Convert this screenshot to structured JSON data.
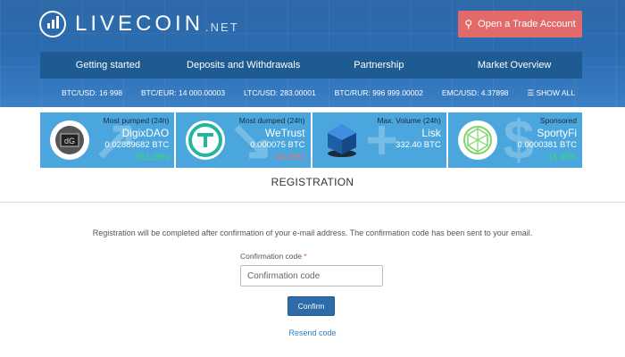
{
  "brand": {
    "name": "LIVECOIN",
    "suffix": ".NET"
  },
  "header": {
    "trade_button": "Open a Trade Account",
    "trade_icon": "user-icon"
  },
  "nav": [
    {
      "label": "Getting started"
    },
    {
      "label": "Deposits and Withdrawals"
    },
    {
      "label": "Partnership"
    },
    {
      "label": "Market Overview"
    }
  ],
  "ticker": [
    {
      "text": "BTC/USD: 16 998"
    },
    {
      "text": "BTC/EUR: 14 000.00003"
    },
    {
      "text": "LTC/USD: 283.00001"
    },
    {
      "text": "BTC/RUR: 996 999.00002"
    },
    {
      "text": "EMC/USD: 4.37898"
    }
  ],
  "show_all": "☰ SHOW ALL",
  "cards": [
    {
      "caption": "Most pumped (24h)",
      "name": "DigixDAO",
      "price": "0.02889682 BTC",
      "change": "451.38%",
      "change_color": "#34e06a",
      "icon": "digixdao-icon"
    },
    {
      "caption": "Most dumped (24h)",
      "name": "WeTrust",
      "price": "0.000075 BTC",
      "change": "-64.89%",
      "change_color": "#f07070",
      "icon": "wetrust-icon"
    },
    {
      "caption": "Max. Volume (24h)",
      "name": "Lisk",
      "price": "332.40 BTC",
      "change": "",
      "change_color": "#ffffff",
      "icon": "lisk-icon"
    },
    {
      "caption": "Sponsored",
      "name": "SportyFi",
      "price": "0.0000381 BTC",
      "change": "16.69%",
      "change_color": "#34e06a",
      "icon": "sportyfi-icon"
    }
  ],
  "registration": {
    "title": "REGISTRATION",
    "info": "Registration will be completed after confirmation of your e-mail address. The confirmation code has been sent to your email.",
    "field_label": "Confirmation code",
    "required_mark": "*",
    "input_value": "",
    "input_placeholder": "Confirmation code",
    "confirm_button": "Confirm",
    "resend_link": "Resend code"
  },
  "colors": {
    "header_bg": "#2a6bb0",
    "nav_bg": "#1e5b92",
    "card_bg": "#4aa6dc",
    "trade_button": "#e36a6a",
    "confirm_button": "#2d6ca8",
    "link": "#2f7fc1"
  }
}
